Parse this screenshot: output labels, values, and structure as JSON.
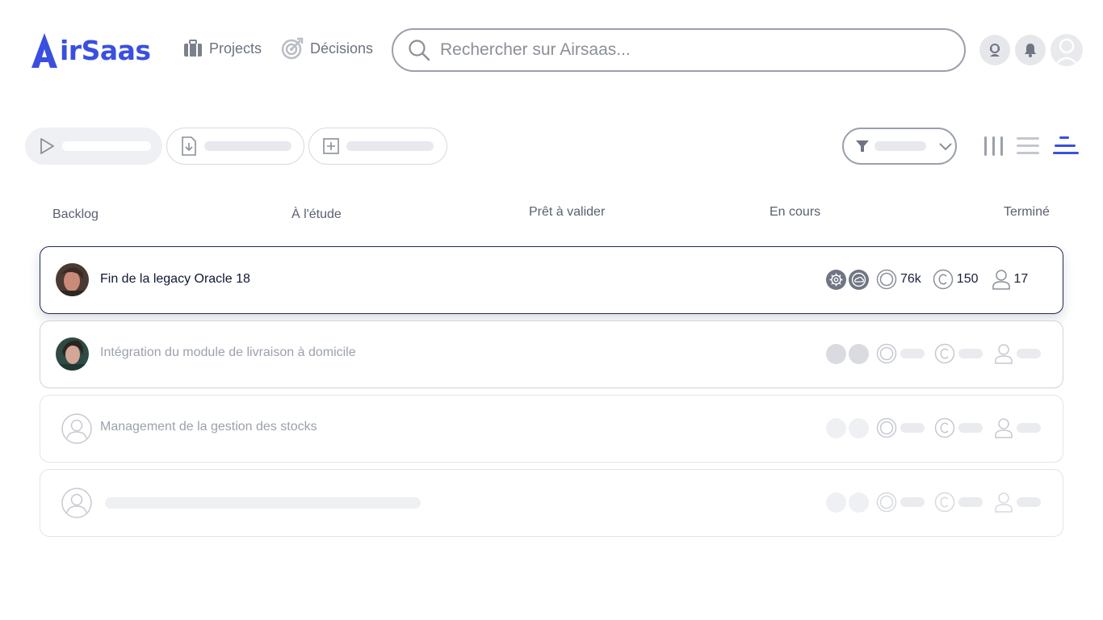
{
  "app": {
    "logo_text": "irSaas",
    "brand_color": "#3a4fe0"
  },
  "nav": {
    "projects": {
      "label": "Projects",
      "icon": "briefcase-icon"
    },
    "decisions": {
      "label": "Décisions",
      "icon": "target-icon"
    }
  },
  "search": {
    "placeholder": "Rechercher sur Airsaas..."
  },
  "top_actions": [
    {
      "icon": "support-icon"
    },
    {
      "icon": "bell-icon"
    },
    {
      "icon": "user-avatar-icon"
    }
  ],
  "toolbar": {
    "buttons": [
      {
        "icon": "play-icon"
      },
      {
        "icon": "import-file-icon"
      },
      {
        "icon": "add-square-icon"
      }
    ],
    "filter_icon": "filter-icon",
    "views": [
      {
        "icon": "columns-view-icon",
        "active": false
      },
      {
        "icon": "list-view-icon",
        "active": false
      },
      {
        "icon": "gantt-view-icon",
        "active": true
      }
    ]
  },
  "statuses": [
    "Backlog",
    "À l'étude",
    "Prêt à valider",
    "En cours",
    "Terminé"
  ],
  "projects": [
    {
      "title": "Fin de la legacy Oracle 18",
      "budget": "76k",
      "effort": "150",
      "people": "17"
    },
    {
      "title": "Intégration du module de livraison à domicile"
    },
    {
      "title": "Management de la gestion des stocks"
    }
  ]
}
